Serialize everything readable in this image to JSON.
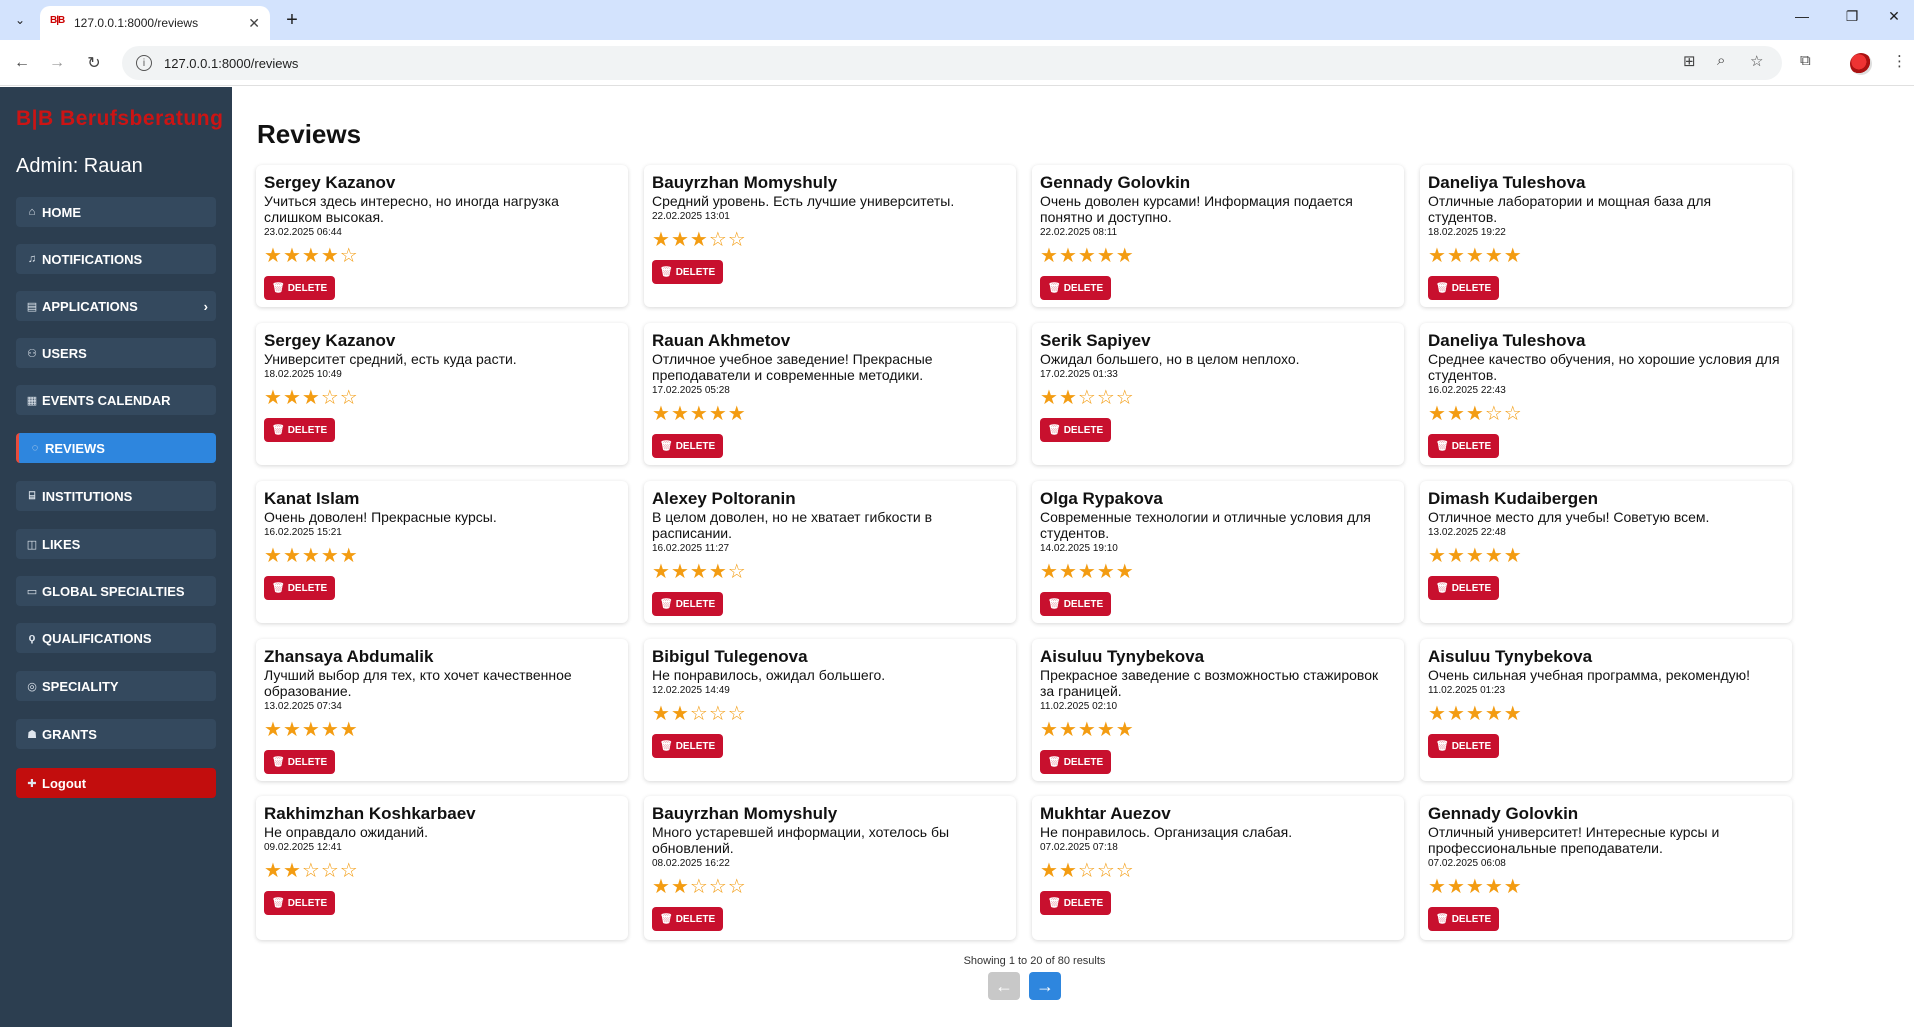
{
  "browser": {
    "tab_title": "127.0.0.1:8000/reviews",
    "favicon_text": "B|B",
    "url": "127.0.0.1:8000/reviews"
  },
  "sidebar": {
    "brand": "B|B  Berufsberatung",
    "admin": "Admin: Rauan",
    "items": [
      {
        "label": "HOME",
        "icon": "home-icon",
        "glyph": "⌂"
      },
      {
        "label": "NOTIFICATIONS",
        "icon": "bell-icon",
        "glyph": "♫"
      },
      {
        "label": "APPLICATIONS",
        "icon": "applications-icon",
        "glyph": "▤",
        "chevron": "›"
      },
      {
        "label": "USERS",
        "icon": "users-icon",
        "glyph": "⚇"
      },
      {
        "label": "EVENTS CALENDAR",
        "icon": "calendar-icon",
        "glyph": "▦"
      },
      {
        "label": "REVIEWS",
        "icon": "reviews-icon",
        "glyph": "◌"
      },
      {
        "label": "INSTITUTIONS",
        "icon": "institution-icon",
        "glyph": "⌸"
      },
      {
        "label": "LIKES",
        "icon": "thumbs-up-icon",
        "glyph": "◫"
      },
      {
        "label": "GLOBAL SPECIALTIES",
        "icon": "briefcase-icon",
        "glyph": "▭"
      },
      {
        "label": "QUALIFICATIONS",
        "icon": "certificate-icon",
        "glyph": "ϙ"
      },
      {
        "label": "SPECIALITY",
        "icon": "globe-icon",
        "glyph": "◎"
      },
      {
        "label": "GRANTS",
        "icon": "medal-icon",
        "glyph": "☗"
      }
    ],
    "logout": {
      "label": "Logout",
      "icon": "logout-icon",
      "glyph": "✚"
    }
  },
  "main": {
    "title": "Reviews",
    "delete_label": "DELETE",
    "star_color": "#f39c12",
    "reviews": [
      {
        "name": "Sergey Kazanov",
        "text": "Учиться здесь интересно, но иногда нагрузка слишком высокая.",
        "date": "23.02.2025 06:44",
        "rating": 4
      },
      {
        "name": "Bauyrzhan Momyshuly",
        "text": "Средний уровень. Есть лучшие университеты.",
        "date": "22.02.2025 13:01",
        "rating": 3
      },
      {
        "name": "Gennady Golovkin",
        "text": "Очень доволен курсами! Информация подается понятно и доступно.",
        "date": "22.02.2025 08:11",
        "rating": 5
      },
      {
        "name": "Daneliya Tuleshova",
        "text": "Отличные лаборатории и мощная база для студентов.",
        "date": "18.02.2025 19:22",
        "rating": 5
      },
      {
        "name": "Sergey Kazanov",
        "text": "Университет средний, есть куда расти.",
        "date": "18.02.2025 10:49",
        "rating": 3
      },
      {
        "name": "Rauan Akhmetov",
        "text": "Отличное учебное заведение! Прекрасные преподаватели и современные методики.",
        "date": "17.02.2025 05:28",
        "rating": 5
      },
      {
        "name": "Serik Sapiyev",
        "text": "Ожидал большего, но в целом неплохо.",
        "date": "17.02.2025 01:33",
        "rating": 2
      },
      {
        "name": "Daneliya Tuleshova",
        "text": "Среднее качество обучения, но хорошие условия для студентов.",
        "date": "16.02.2025 22:43",
        "rating": 3
      },
      {
        "name": "Kanat Islam",
        "text": "Очень доволен! Прекрасные курсы.",
        "date": "16.02.2025 15:21",
        "rating": 5
      },
      {
        "name": "Alexey Poltoranin",
        "text": "В целом доволен, но не хватает гибкости в расписании.",
        "date": "16.02.2025 11:27",
        "rating": 4
      },
      {
        "name": "Olga Rypakova",
        "text": "Современные технологии и отличные условия для студентов.",
        "date": "14.02.2025 19:10",
        "rating": 5
      },
      {
        "name": "Dimash Kudaibergen",
        "text": "Отличное место для учебы! Советую всем.",
        "date": "13.02.2025 22:48",
        "rating": 5
      },
      {
        "name": "Zhansaya Abdumalik",
        "text": "Лучший выбор для тех, кто хочет качественное образование.",
        "date": "13.02.2025 07:34",
        "rating": 5
      },
      {
        "name": "Bibigul Tulegenova",
        "text": "Не понравилось, ожидал большего.",
        "date": "12.02.2025 14:49",
        "rating": 2
      },
      {
        "name": "Aisuluu Tynybekova",
        "text": "Прекрасное заведение с возможностью стажировок за границей.",
        "date": "11.02.2025 02:10",
        "rating": 5
      },
      {
        "name": "Aisuluu Tynybekova",
        "text": "Очень сильная учебная программа, рекомендую!",
        "date": "11.02.2025 01:23",
        "rating": 5
      },
      {
        "name": "Rakhimzhan Koshkarbaev",
        "text": "Не оправдало ожиданий.",
        "date": "09.02.2025 12:41",
        "rating": 2
      },
      {
        "name": "Bauyrzhan Momyshuly",
        "text": "Много устаревшей информации, хотелось бы обновлений.",
        "date": "08.02.2025 16:22",
        "rating": 2
      },
      {
        "name": "Mukhtar Auezov",
        "text": "Не понравилось. Организация слабая.",
        "date": "07.02.2025 07:18",
        "rating": 2
      },
      {
        "name": "Gennady Golovkin",
        "text": "Отличный университет! Интересные курсы и профессиональные преподаватели.",
        "date": "07.02.2025 06:08",
        "rating": 5
      }
    ],
    "pagination": {
      "summary": "Showing 1 to 20 of 80 results",
      "prev": "←",
      "next": "→"
    }
  }
}
